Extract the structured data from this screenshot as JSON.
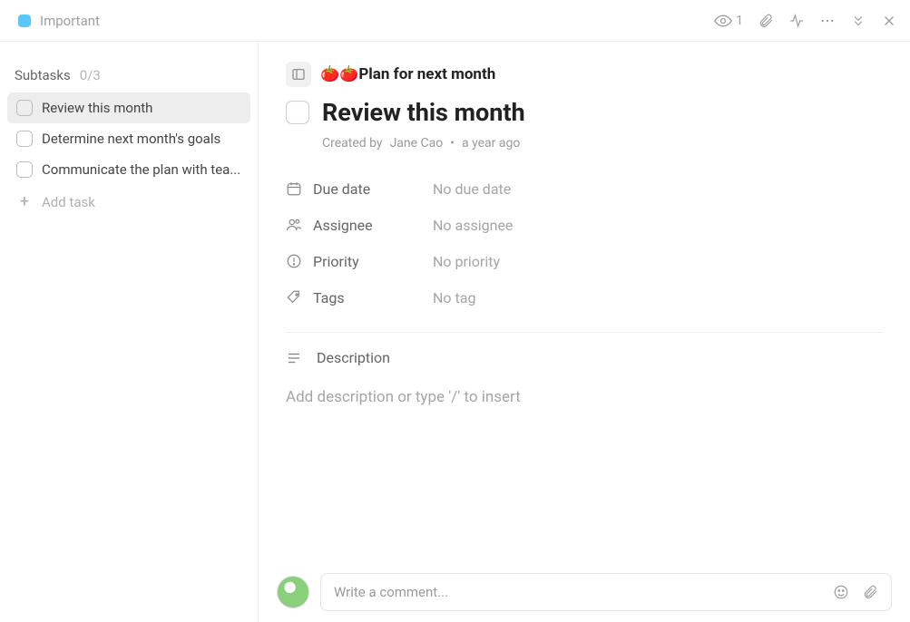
{
  "header": {
    "list_name": "Important",
    "view_count": "1"
  },
  "sidebar": {
    "title": "Subtasks",
    "count": "0/3",
    "items": [
      {
        "title": "Review this month"
      },
      {
        "title": "Determine next month's goals"
      },
      {
        "title": "Communicate the plan with tea..."
      }
    ],
    "add_label": "Add task"
  },
  "main": {
    "parent_task": "🍅🍅Plan for next month",
    "title": "Review this month",
    "created_by_prefix": "Created by",
    "created_by": "Jane Cao",
    "created_ago": "a year ago",
    "fields": {
      "due": {
        "label": "Due date",
        "value": "No due date"
      },
      "assignee": {
        "label": "Assignee",
        "value": "No assignee"
      },
      "priority": {
        "label": "Priority",
        "value": "No priority"
      },
      "tags": {
        "label": "Tags",
        "value": "No tag"
      }
    },
    "description_label": "Description",
    "description_placeholder": "Add description or type '/' to insert"
  },
  "comment": {
    "placeholder": "Write a comment..."
  }
}
